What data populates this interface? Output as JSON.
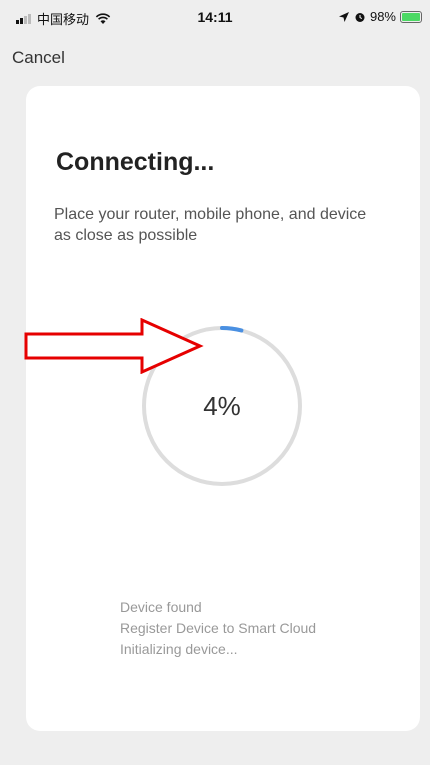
{
  "status_bar": {
    "carrier": "中国移动",
    "time": "14:11",
    "battery": "98%",
    "battery_level": 0.98,
    "icons": [
      "signal-icon",
      "wifi-icon",
      "location-icon",
      "alarm-icon",
      "battery-icon"
    ]
  },
  "nav": {
    "cancel_label": "Cancel"
  },
  "connect": {
    "title": "Connecting...",
    "subtitle": "Place your router, mobile phone, and device as close as possible",
    "progress_label": "4%",
    "progress_value": 0.04,
    "steps": [
      "Device found",
      "Register Device to Smart Cloud",
      "Initializing device..."
    ]
  },
  "colors": {
    "progress": "#4a90e2",
    "track": "#dddddd",
    "annotation": "#e60000"
  }
}
